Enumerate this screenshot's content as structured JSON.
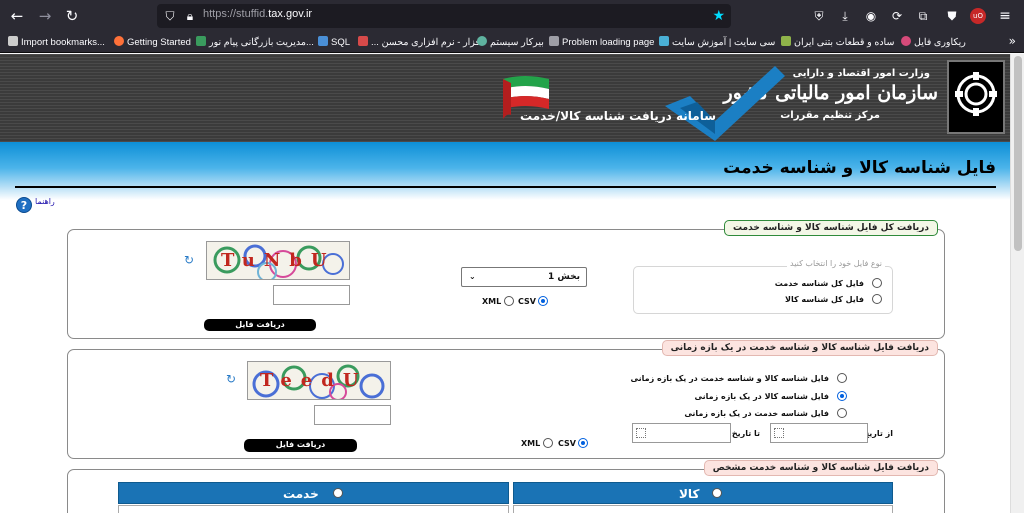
{
  "browser": {
    "url_prefix": "https://",
    "url_host": "stuffid.",
    "url_domain": "tax.gov.ir",
    "bookmarks": [
      {
        "label": "Import bookmarks...",
        "color": "#cccccc"
      },
      {
        "label": "Getting Started",
        "color": "#ff7139"
      },
      {
        "label": "مدیریت بازرگانی پیام نور...",
        "color": "#3a9b5e"
      },
      {
        "label": "SQL",
        "color": "#4a8fd6"
      },
      {
        "label": "... افزار - نرم افزاری محسن",
        "color": "#d64a4a"
      },
      {
        "label": "بیرکار سیستم",
        "color": "#5fb3a0"
      },
      {
        "label": "Problem loading page",
        "color": "#9e9ea6"
      },
      {
        "label": "سی سایت | آموزش سایت",
        "color": "#4ab0d6"
      },
      {
        "label": "ساده و قطعات بتنی ایران",
        "color": "#8fb34a"
      },
      {
        "label": "ریکاوری فایل",
        "color": "#d64a7a"
      }
    ]
  },
  "header": {
    "ministry": "وزارت امور اقتصاد و دارایی",
    "org_name": "سازمان امور مالیاتی کشور",
    "org_sub": "مرکز تنظیم مقررات",
    "system_title": "سامانه دریافت شناسه کالا/خدمت"
  },
  "page": {
    "title": "فایل شناسه کالا و شناسه خدمت",
    "help": "راهنما"
  },
  "section1": {
    "legend": "دریافت کل فایل شناسه کالا و شناسه خدمت",
    "file_type_legend": "نوع فایل خود را انتخاب کنید",
    "options": [
      "فایل کل شناسه خدمت",
      "فایل کل شناسه کالا"
    ],
    "part_select": "بخش 1",
    "format_csv": "CSV",
    "format_xml": "XML",
    "captcha": "TuNbU",
    "button": "دریافت فایل"
  },
  "section2": {
    "legend": "دریافت فایل شناسه کالا و شناسه خدمت در یک بازه زمانی",
    "options": [
      "فایل شناسه کالا و شناسه خدمت در یک بازه زمانی",
      "فایل شناسه کالا در یک بازه زمانی",
      "فایل شناسه خدمت در یک بازه زمانی"
    ],
    "from_date": "از تاریخ",
    "to_date": "تا تاریخ",
    "format_csv": "CSV",
    "format_xml": "XML",
    "captcha": "TeedU",
    "button": "دریافت فایل"
  },
  "section3": {
    "legend": "دریافت فایل شناسه کالا و شناسه خدمت مشخص",
    "tab_goods": "کالا",
    "tab_service": "خدمت"
  }
}
